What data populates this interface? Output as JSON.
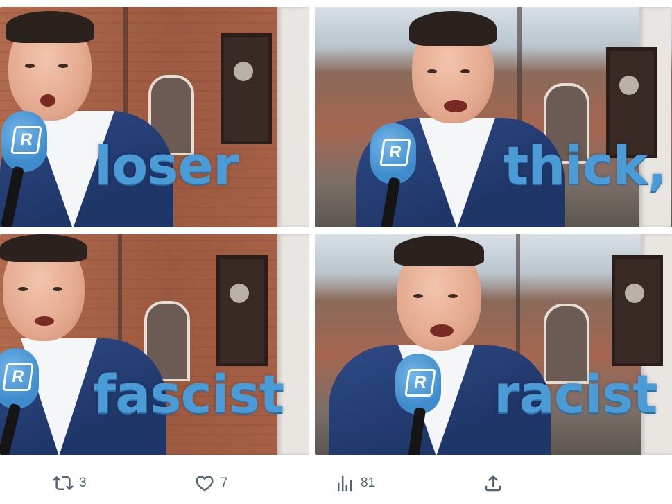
{
  "panels": [
    {
      "caption": "loser"
    },
    {
      "caption": "thick,"
    },
    {
      "caption": "fascist"
    },
    {
      "caption": "racist"
    }
  ],
  "mic_logo": "R",
  "actions": {
    "retweet_count": "3",
    "like_count": "7",
    "views_count": "81"
  },
  "icons": [
    "retweet-icon",
    "heart-icon",
    "analytics-icon",
    "share-icon"
  ],
  "colors": {
    "caption": "#4a9bd6",
    "icon_gray": "#536471"
  }
}
